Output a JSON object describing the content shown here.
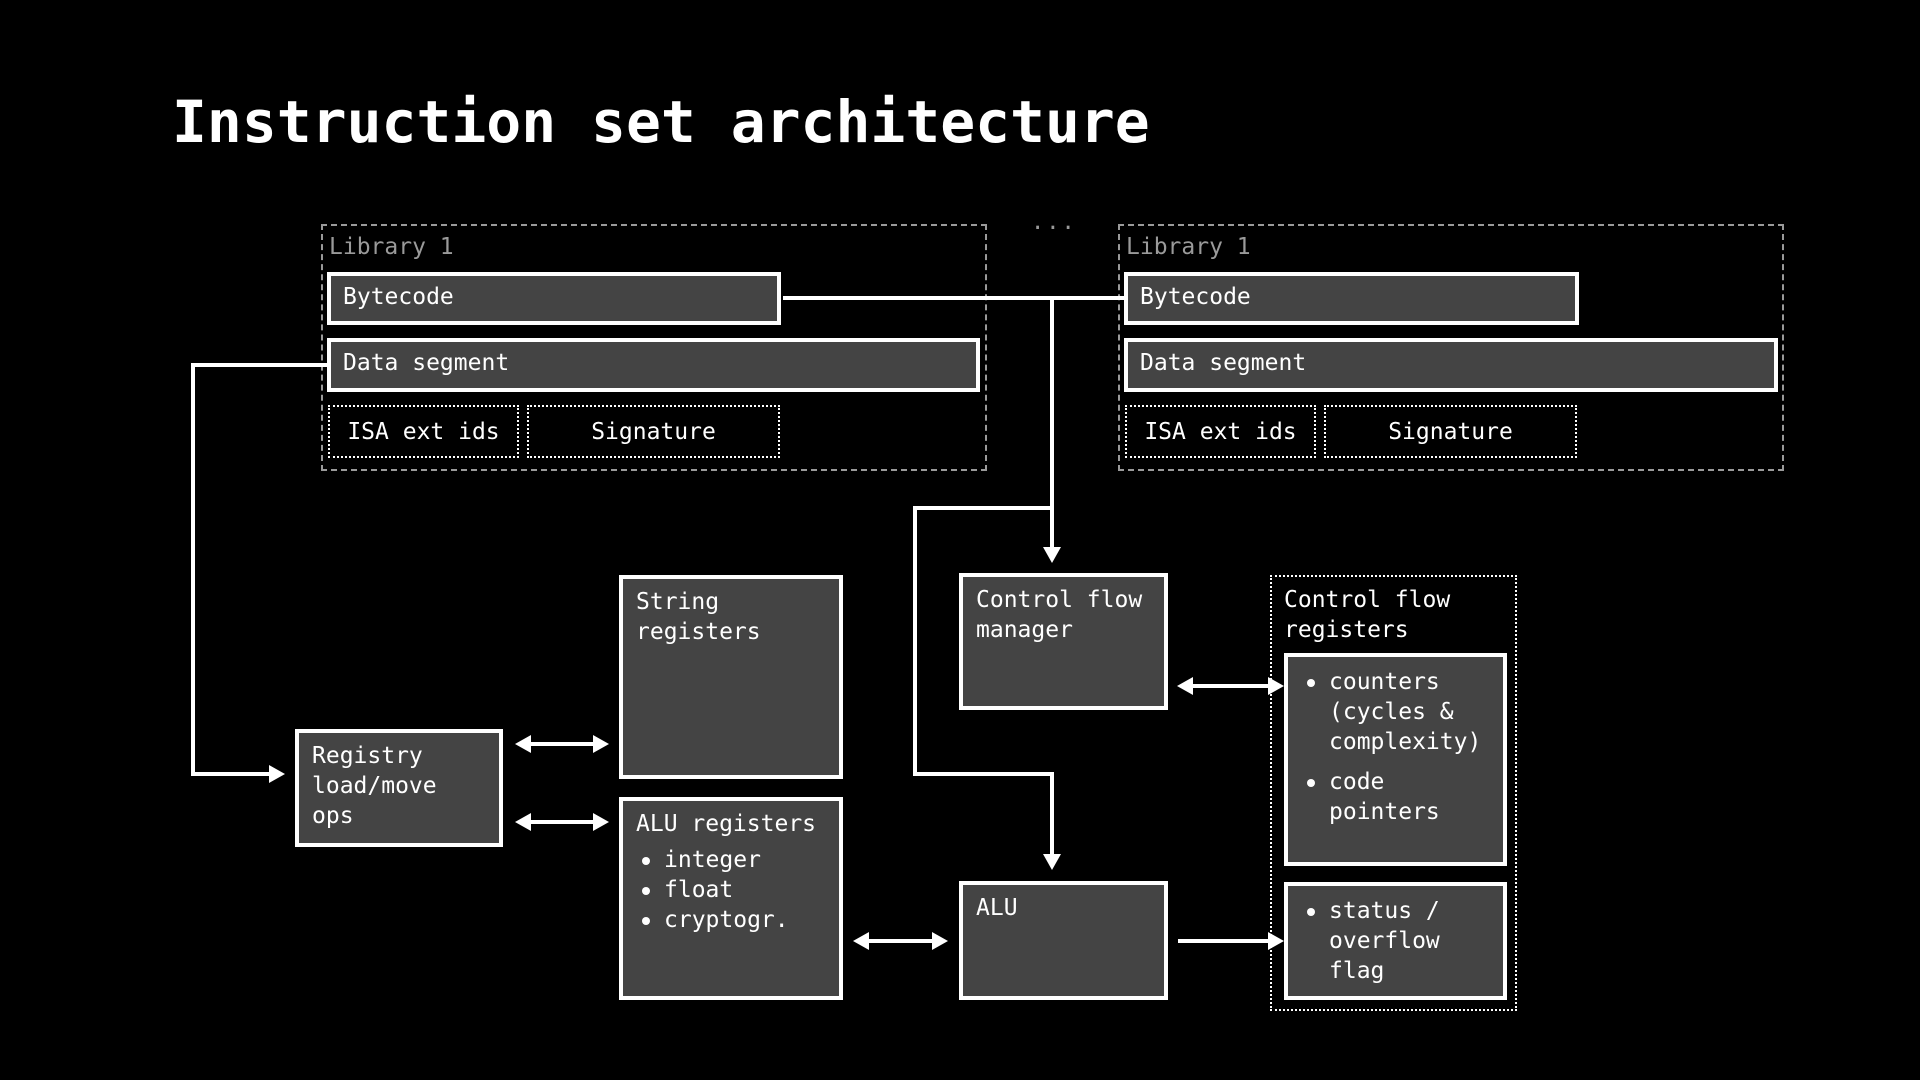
{
  "title": "Instruction set architecture",
  "ellipsis": "...",
  "libraries": [
    {
      "label": "Library 1",
      "bytecode": "Bytecode",
      "data_segment": "Data segment",
      "isa_ext_ids": "ISA ext ids",
      "signature": "Signature"
    },
    {
      "label": "Library 1",
      "bytecode": "Bytecode",
      "data_segment": "Data segment",
      "isa_ext_ids": "ISA ext ids",
      "signature": "Signature"
    }
  ],
  "blocks": {
    "registry_ops": {
      "title": "Registry\nload/move\nops"
    },
    "string_registers": {
      "title": "String\nregisters"
    },
    "alu_registers": {
      "title": "ALU registers",
      "items": [
        "integer",
        "float",
        "cryptogr."
      ]
    },
    "control_flow_manager": {
      "title": "Control flow\nmanager"
    },
    "alu": {
      "title": "ALU"
    },
    "control_flow_registers": {
      "title": "Control flow\nregisters",
      "counters_items": [
        "counters\n(cycles &\ncomplexity)",
        "code\npointers"
      ],
      "status_items": [
        "status /\noverflow\nflag"
      ]
    }
  },
  "colors": {
    "background": "#000000",
    "box_fill": "#444444",
    "stroke": "#ffffff",
    "muted": "#9a9a9a"
  }
}
